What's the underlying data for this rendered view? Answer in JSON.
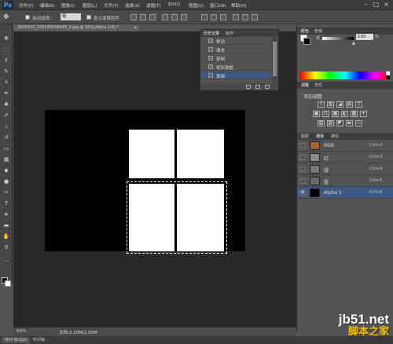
{
  "app": {
    "logo": "Ps"
  },
  "menu": [
    "文件(F)",
    "编辑(E)",
    "图像(I)",
    "图层(L)",
    "文字(Y)",
    "选择(S)",
    "滤镜(T)",
    "3D(D)",
    "视图(V)",
    "窗口(W)",
    "帮助(H)"
  ],
  "window_controls": {
    "minimize": "–",
    "restore": "□",
    "close": "×"
  },
  "options": {
    "auto_select_label": "自动选择：",
    "auto_select_value": "组",
    "show_transform_label": "显示变换控件"
  },
  "document": {
    "tab_title": "2926432_200148048048_2.jpg @ 50%(Alpha 1/8) *",
    "tab_close": "×",
    "zoom": "50%",
    "doc_size": "文档:2.10M/2.55M"
  },
  "history_panel": {
    "tabs": [
      "历史记录",
      "操作"
    ],
    "items": [
      {
        "label": "移动",
        "active": false
      },
      {
        "label": "填充",
        "active": false
      },
      {
        "label": "复制",
        "active": false
      },
      {
        "label": "矩形选框",
        "active": false
      },
      {
        "label": "复制",
        "active": true
      }
    ]
  },
  "color_panel": {
    "tabs": [
      "颜色",
      "色板"
    ],
    "channel_label": "K",
    "value": "100",
    "unit": "%",
    "thumb": "▲"
  },
  "adjust_panel": {
    "tabs": [
      "调整",
      "样式"
    ],
    "title": "添加调整",
    "row1": [
      "☼",
      "▥",
      "◢",
      "▤",
      "▽"
    ],
    "row2": [
      "▣",
      "⚖",
      "▦",
      "◐",
      "▩",
      "✦"
    ],
    "row3": [
      "▧",
      "▨",
      "◤",
      "▬",
      "▭"
    ]
  },
  "channels_panel": {
    "tabs": [
      "图层",
      "通道",
      "路径"
    ],
    "channels": [
      {
        "label": "RGB",
        "shortcut": "Ctrl+2",
        "visible": false,
        "active": false,
        "thumb": "#b06020"
      },
      {
        "label": "红",
        "shortcut": "Ctrl+3",
        "visible": false,
        "active": false,
        "thumb": "#8a8a8a"
      },
      {
        "label": "绿",
        "shortcut": "Ctrl+4",
        "visible": false,
        "active": false,
        "thumb": "#7a7a7a"
      },
      {
        "label": "蓝",
        "shortcut": "Ctrl+5",
        "visible": false,
        "active": false,
        "thumb": "#6a6a6a"
      },
      {
        "label": "Alpha 1",
        "shortcut": "Ctrl+6",
        "visible": true,
        "active": true,
        "thumb": "#000000"
      }
    ]
  },
  "bottom_tabs": [
    "Mini Bridge",
    "时间轴"
  ],
  "watermark": {
    "url": "jb51.net",
    "text": "脚本之家"
  },
  "colors": {
    "accent": "#3d5a84",
    "canvas_bg": "#282828",
    "panel_bg": "#535353",
    "watermark_yellow": "#f5c200"
  }
}
